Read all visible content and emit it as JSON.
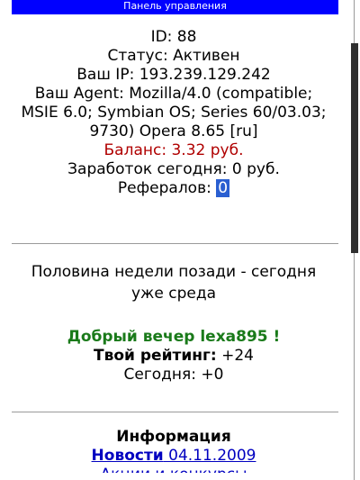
{
  "header": {
    "title": "Панель управления"
  },
  "account": {
    "id": "ID: 88",
    "status": "Статус: Активен",
    "ip": "Ваш IP: 193.239.129.242",
    "agent_lines": [
      "Ваш Agent: Mozilla/4.0 (compatible;",
      "MSIE 6.0; Symbian OS; Series 60/03.03;",
      "9730) Opera 8.65 [ru]"
    ],
    "balance": "Баланс: 3.32 руб.",
    "earnings_today": "Заработок сегодня: 0 руб.",
    "referrals_label": "Рефералов: ",
    "referrals_count": "0"
  },
  "notice": {
    "lines": [
      "Половина недели позади - сегодня",
      "уже среда"
    ]
  },
  "greeting": {
    "text": "Добрый вечер lexa895 !",
    "rating_label": "Твой рейтинг:",
    "rating_value": " +24",
    "today": "Сегодня: +0"
  },
  "information": {
    "title": "Информация",
    "news_label": "Новости",
    "news_date": " 04.11.2009",
    "next_link_partial": "Акции и конкурсы"
  },
  "colors": {
    "header_bg": "#0000ff",
    "balance": "#b00000",
    "greeting": "#1a7a1a",
    "link": "#0000c0"
  }
}
